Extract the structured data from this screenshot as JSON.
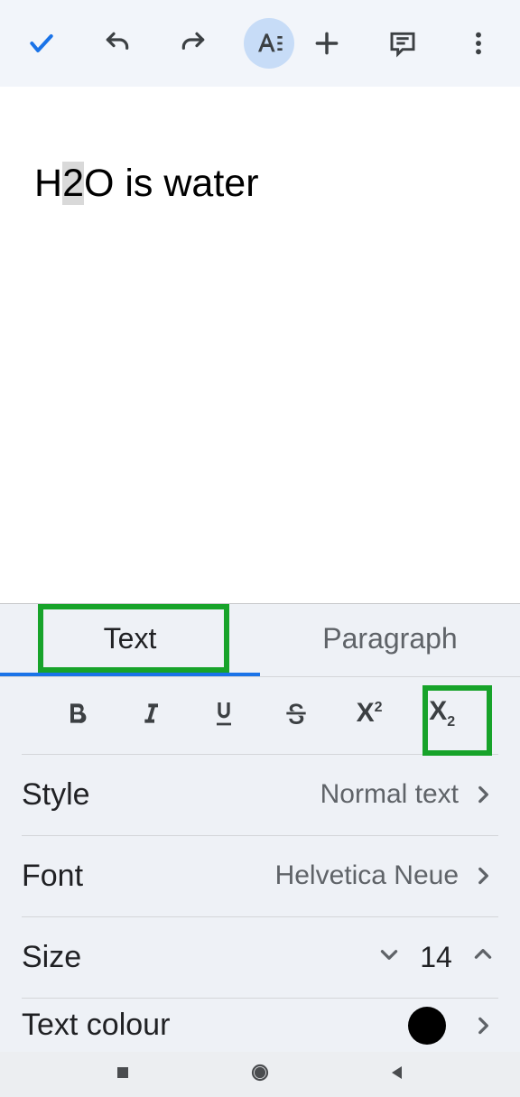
{
  "document": {
    "text_before_sel": "H",
    "text_sel": "2",
    "text_after_sel": "O is water"
  },
  "tabs": {
    "text": "Text",
    "paragraph": "Paragraph"
  },
  "settings": {
    "style_label": "Style",
    "style_value": "Normal text",
    "font_label": "Font",
    "font_value": "Helvetica Neue",
    "size_label": "Size",
    "size_value": "14",
    "text_colour_label": "Text colour"
  }
}
